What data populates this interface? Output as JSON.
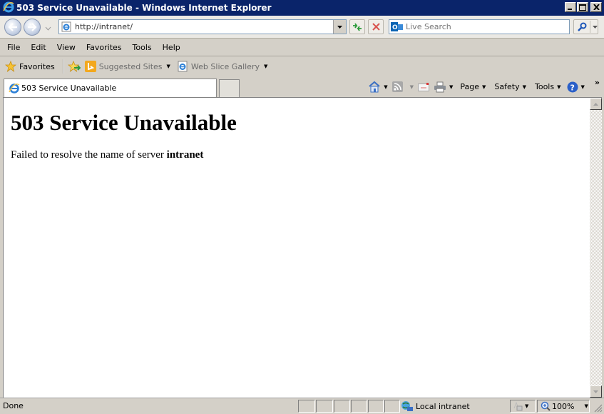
{
  "window": {
    "title": "503 Service Unavailable - Windows Internet Explorer",
    "controls": [
      "minimize",
      "maximize",
      "close"
    ]
  },
  "navbar": {
    "back_label": "Back",
    "forward_label": "Forward",
    "address": "http://intranet/",
    "search_placeholder": "Live Search",
    "icons": [
      "back-icon",
      "forward-icon",
      "recent-pages-icon",
      "ie-page-icon",
      "refresh-icon",
      "stop-icon",
      "live-search-icon",
      "search-icon"
    ]
  },
  "menubar": {
    "items": [
      "File",
      "Edit",
      "View",
      "Favorites",
      "Tools",
      "Help"
    ]
  },
  "favorites_bar": {
    "favorites_label": "Favorites",
    "items": [
      {
        "label": "Suggested Sites",
        "icon": "bing-icon"
      },
      {
        "label": "Web Slice Gallery",
        "icon": "ie-page-icon"
      }
    ]
  },
  "tabs": [
    {
      "label": "503 Service Unavailable",
      "active": true
    }
  ],
  "command_bar": {
    "items": [
      "Page",
      "Safety",
      "Tools"
    ],
    "icons": [
      "home-icon",
      "rss-icon",
      "mail-icon",
      "print-icon",
      "help-icon"
    ],
    "overflow": "»"
  },
  "page": {
    "heading": "503 Service Unavailable",
    "message_prefix": "Failed to resolve the name of server ",
    "server_name": "intranet"
  },
  "statusbar": {
    "status": "Done",
    "zone": "Local intranet",
    "zoom": "100%"
  }
}
